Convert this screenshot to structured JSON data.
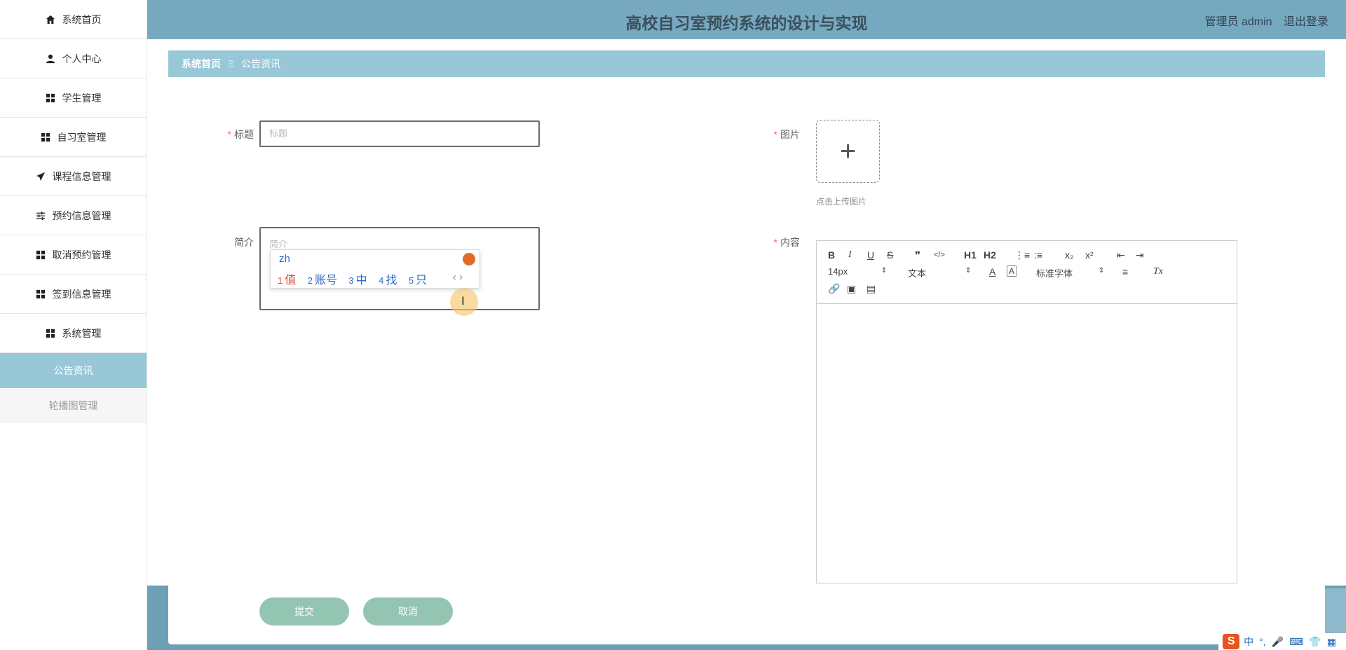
{
  "header": {
    "title": "高校自习室预约系统的设计与实现",
    "user_label": "管理员 admin",
    "logout_label": "退出登录"
  },
  "sidebar": {
    "items": [
      {
        "label": "系统首页",
        "icon": "home-icon"
      },
      {
        "label": "个人中心",
        "icon": "user-icon"
      },
      {
        "label": "学生管理",
        "icon": "grid-icon"
      },
      {
        "label": "自习室管理",
        "icon": "grid-icon"
      },
      {
        "label": "课程信息管理",
        "icon": "send-icon"
      },
      {
        "label": "预约信息管理",
        "icon": "sliders-icon"
      },
      {
        "label": "取消预约管理",
        "icon": "grid-icon"
      },
      {
        "label": "签到信息管理",
        "icon": "grid-icon"
      },
      {
        "label": "系统管理",
        "icon": "grid-icon"
      }
    ],
    "sub_items": [
      {
        "label": "公告资讯",
        "active": true
      },
      {
        "label": "轮播图管理",
        "active": false
      }
    ]
  },
  "breadcrumb": {
    "home": "系统首页",
    "separator": "Ξ",
    "current": "公告资讯"
  },
  "form": {
    "title_label": "标题",
    "title_placeholder": "标题",
    "intro_label": "简介",
    "intro_placeholder": "简介",
    "image_label": "图片",
    "upload_plus": "+",
    "upload_hint": "点击上传图片",
    "content_label": "内容",
    "required_mark": "*"
  },
  "ime": {
    "composition": "zh",
    "candidates": [
      {
        "num": "1",
        "text": "值"
      },
      {
        "num": "2",
        "text": "账号"
      },
      {
        "num": "3",
        "text": "中"
      },
      {
        "num": "4",
        "text": "找"
      },
      {
        "num": "5",
        "text": "只"
      }
    ],
    "prev": "‹",
    "next": "›"
  },
  "editor": {
    "bold": "B",
    "italic": "I",
    "underline": "U",
    "strike": "S",
    "quote": "❞",
    "code": "</>",
    "h1": "H1",
    "h2": "H2",
    "font_size": "14px",
    "paragraph": "文本",
    "font_family": "标准字体",
    "sub": "x₂",
    "sup": "x²",
    "clean": "Tx"
  },
  "buttons": {
    "submit": "提交",
    "cancel": "取消"
  },
  "tray": {
    "logo": "S",
    "mode": "中",
    "punct": "°,"
  },
  "colors": {
    "header_bg": "#76a9c0",
    "breadcrumb_bg": "#98c8d8",
    "button_bg": "#94c5b3",
    "required": "#f56c6c"
  }
}
